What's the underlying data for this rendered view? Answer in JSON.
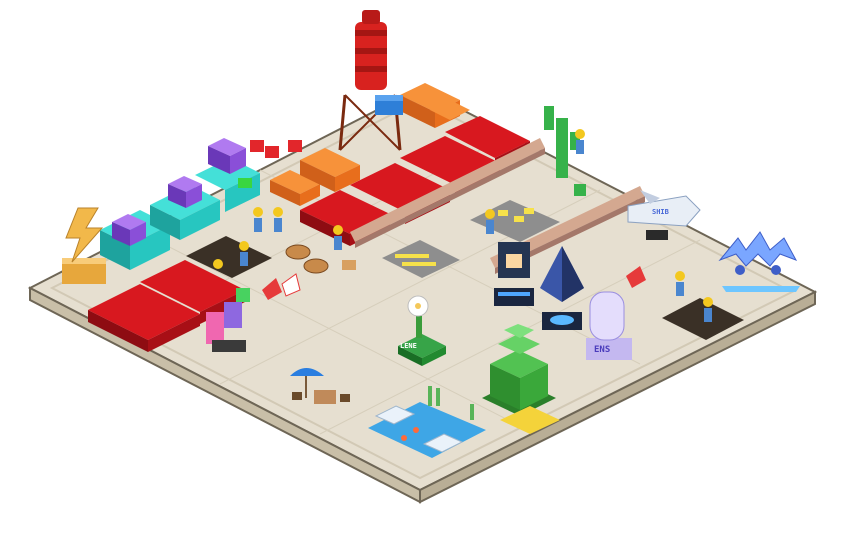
{
  "scene": {
    "labels": {
      "plant_sign": "LENE",
      "monument_sign": "ENS",
      "jet_text": "SHIB"
    },
    "colors": {
      "ground_top": "#e6dfd0",
      "ground_side": "#c9bfa8",
      "ground_edge": "#8c8270",
      "red_block": "#c8101a",
      "orange_crate": "#f07a1e",
      "teal_machine": "#27c6c0",
      "purple_cube": "#8a4fd8",
      "tower_red": "#d8221f",
      "tree_green": "#3aa83a",
      "water_blue": "#3ea6e6",
      "eth_navy": "#223366",
      "gold_statue": "#f2b84a"
    },
    "icons": [
      "water-tower-icon",
      "lightning-statue-icon",
      "cactus-icon",
      "jet-icon",
      "bat-wings-icon",
      "ethereum-crystal-icon",
      "robot-icon",
      "flower-plant-icon",
      "voxel-tree-icon",
      "pond-icon",
      "umbrella-icon",
      "construction-worker-icon",
      "cable-reel-icon"
    ]
  }
}
